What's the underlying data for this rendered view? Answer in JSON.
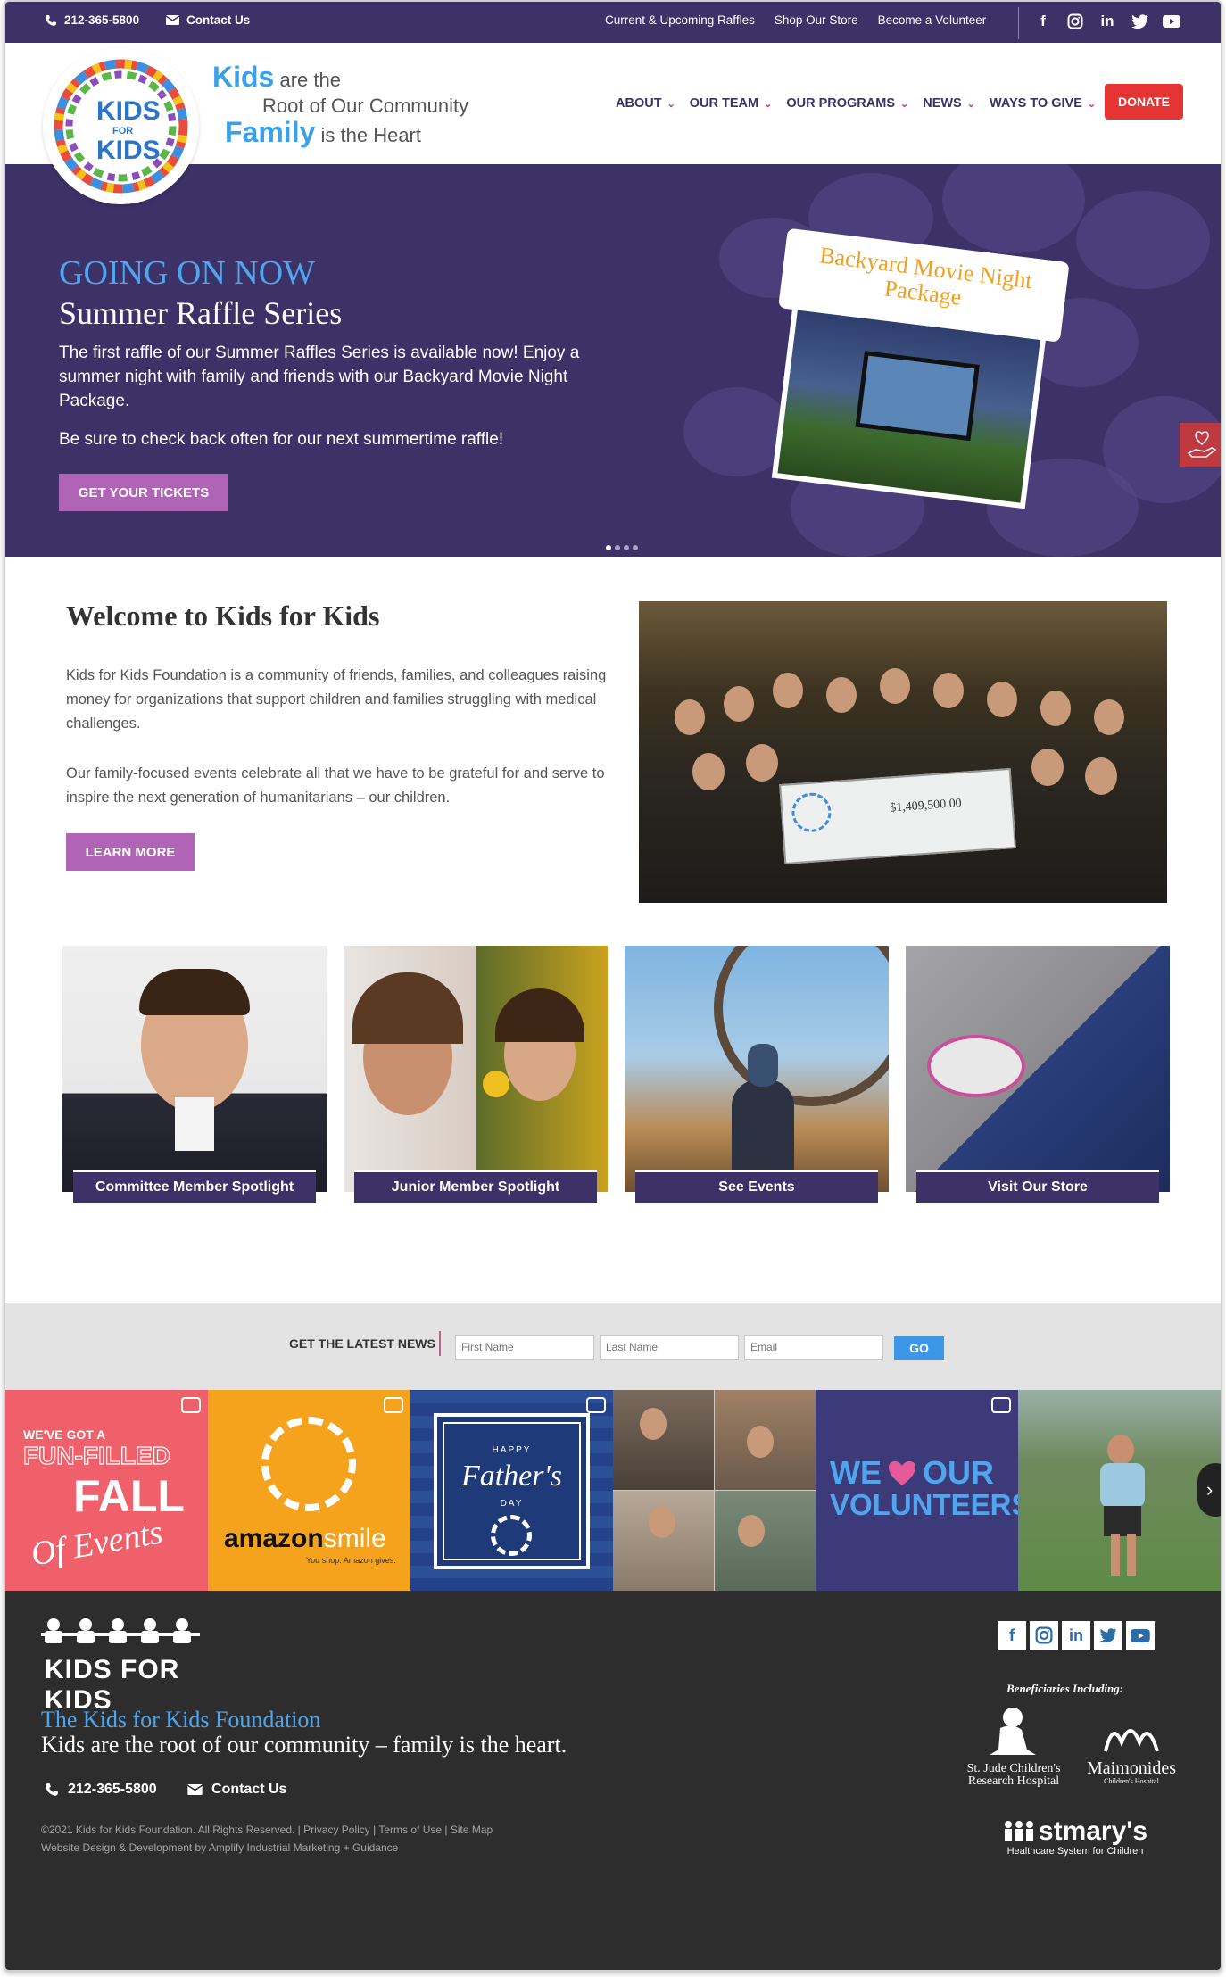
{
  "topbar": {
    "phone": "212-365-5800",
    "contact": "Contact Us",
    "links": [
      "Current & Upcoming Raffles",
      "Shop Our Store",
      "Become a Volunteer"
    ],
    "social_icons": [
      "facebook-icon",
      "instagram-icon",
      "linkedin-icon",
      "twitter-icon",
      "youtube-icon"
    ]
  },
  "header": {
    "tagline": {
      "kids": "Kids",
      "are_the": "are the",
      "root": "Root of Our Community",
      "family": "Family",
      "is_heart": "is the Heart"
    },
    "nav": [
      "ABOUT",
      "OUR TEAM",
      "OUR PROGRAMS",
      "NEWS",
      "WAYS TO GIVE"
    ],
    "donate": "DONATE"
  },
  "hero": {
    "kicker": "GOING ON NOW",
    "title": "Summer Raffle Series",
    "body": "The first raffle of our Summer Raffles Series is available now! Enjoy a summer night with family and friends with our Backyard Movie Night Package.",
    "body2": "Be sure to check back often for our next summertime raffle!",
    "button": "GET YOUR TICKETS",
    "ticket_text": "Backyard Movie Night Package",
    "slide_count": 4,
    "active_slide": 1
  },
  "welcome": {
    "title": "Welcome to Kids for Kids",
    "p1": "Kids for Kids Foundation is a community of friends, families, and colleagues raising money for organizations that support children and families struggling with medical challenges.",
    "p2": "Our family-focused events celebrate all that we have to be grateful for and serve to inspire the next generation of humanitarians – our children.",
    "button": "LEARN MORE",
    "check_amount": "$1,409,500.00"
  },
  "tiles": [
    {
      "caption": "Committee Member Spotlight"
    },
    {
      "caption": "Junior Member Spotlight"
    },
    {
      "caption": "See Events"
    },
    {
      "caption": "Visit Our Store"
    }
  ],
  "news": {
    "label": "GET THE LATEST NEWS",
    "first_placeholder": "First Name",
    "last_placeholder": "Last Name",
    "email_placeholder": "Email",
    "go": "GO"
  },
  "instagram": {
    "post1": {
      "a": "WE'VE GOT A",
      "b": "FUN-FILLED",
      "c": "FALL",
      "d": "Of Events"
    },
    "post2": {
      "brand": "amazon",
      "smile": "smile",
      "tag": "You shop. Amazon gives."
    },
    "post3": {
      "a": "HAPPY",
      "b": "Father's",
      "c": "DAY"
    },
    "post5": {
      "a": "WE",
      "b": "OUR",
      "c": "VOLUNTEERS"
    }
  },
  "footer": {
    "logo_text": "KIDS FOR KIDS",
    "title": "The Kids for Kids Foundation",
    "subtitle": "Kids are the root of our community – family is the heart.",
    "phone": "212-365-5800",
    "contact": "Contact Us",
    "copyright": "©2021 Kids for Kids Foundation. All Rights Reserved. | Privacy Policy | Terms of Use | Site Map",
    "credit": "Website Design & Development by Amplify Industrial Marketing + Guidance",
    "beneficiaries_label": "Beneficiaries Including:",
    "beneficiaries": [
      {
        "name": "St. Jude Children's",
        "sub": "Research Hospital"
      },
      {
        "name": "Maimonides",
        "sub": "Children's Hospital"
      },
      {
        "name": "stmary's",
        "sub": "Healthcare System for Children"
      }
    ]
  },
  "colors": {
    "purple": "#3d3268",
    "accent_blue": "#4fa6ee",
    "button_purple": "#b064b5",
    "donate_red": "#e63333"
  }
}
